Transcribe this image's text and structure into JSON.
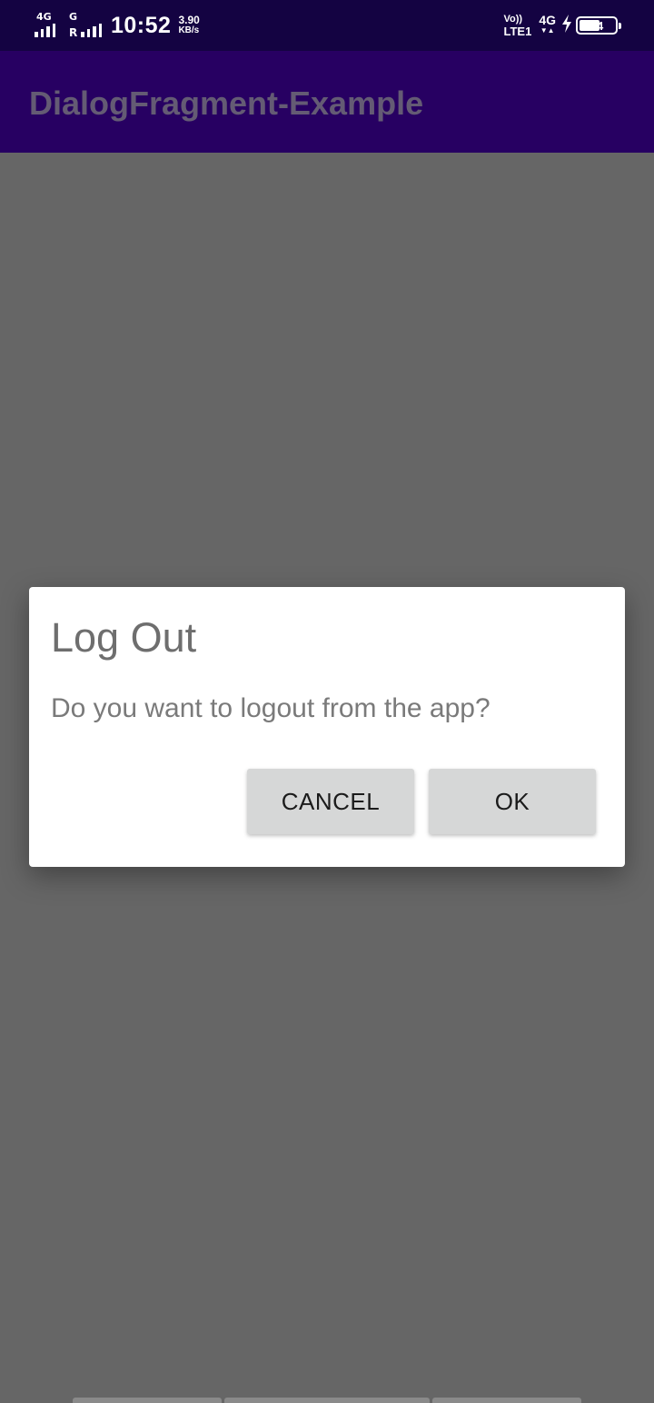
{
  "status_bar": {
    "sim1_tag": "4G",
    "sim2_tag": "G",
    "sim2_roaming": "R",
    "time": "10:52",
    "speed_value": "3.90",
    "speed_unit": "KB/s",
    "volte_top": "Vo))",
    "volte_bottom": "LTE1",
    "network": "4G",
    "battery_level": "54",
    "icons": [
      "signal-icon",
      "signal-icon",
      "volte-icon",
      "network-icon",
      "charging-icon",
      "battery-icon"
    ]
  },
  "app_bar": {
    "title": "DialogFragment-Example"
  },
  "dialog": {
    "title": "Log Out",
    "message": "Do you want to logout from the app?",
    "cancel_label": "CANCEL",
    "ok_label": "OK"
  },
  "colors": {
    "status_bar": "#140342",
    "app_bar": "#270062",
    "scrim": "#666666",
    "dialog_bg": "#ffffff",
    "button_bg": "#d6d7d7"
  }
}
